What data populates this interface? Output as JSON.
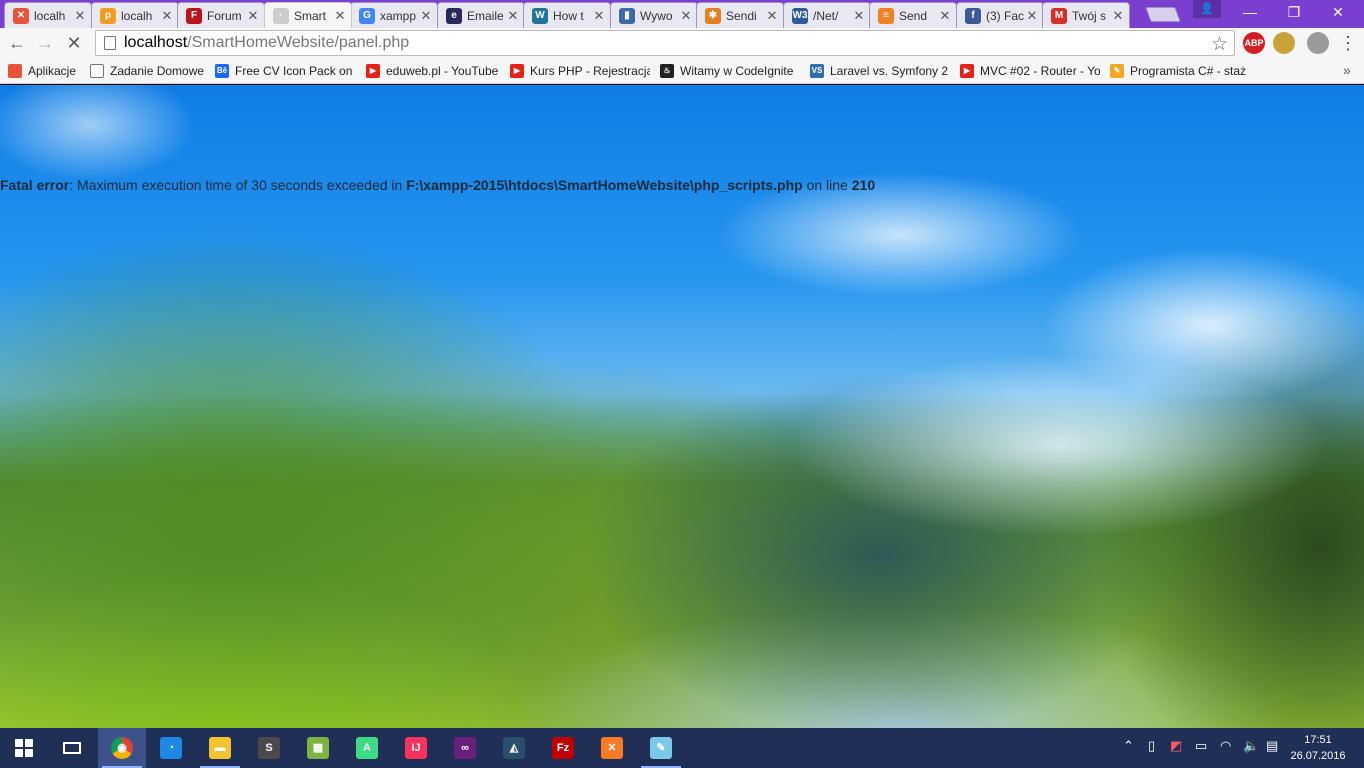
{
  "colors": {
    "titlebar": "#7a3fd1",
    "toolbar": "#f6f6f6",
    "taskbar": "#1f2f55"
  },
  "tabs": [
    {
      "label": "localh",
      "icon": "xampp-icon",
      "color": "#e8543a",
      "glyph": "✕"
    },
    {
      "label": "localh",
      "icon": "phpmyadmin-icon",
      "color": "#f39c1f",
      "glyph": "p"
    },
    {
      "label": "Forum",
      "icon": "forum-icon",
      "color": "#b8161b",
      "glyph": "F"
    },
    {
      "label": "Smart",
      "icon": "loading-icon",
      "color": "#cccccc",
      "glyph": "·",
      "active": true
    },
    {
      "label": "xampp",
      "icon": "google-icon",
      "color": "#4285f4",
      "glyph": "G"
    },
    {
      "label": "Emaile",
      "icon": "ie-icon",
      "color": "#2a2a5a",
      "glyph": "e"
    },
    {
      "label": "How t",
      "icon": "wordpress-icon",
      "color": "#21759b",
      "glyph": "W"
    },
    {
      "label": "Wywo",
      "icon": "bookmark-icon",
      "color": "#3a6aa8",
      "glyph": "▮"
    },
    {
      "label": "Sendi",
      "icon": "asterisk-icon",
      "color": "#e67e22",
      "glyph": "✱"
    },
    {
      "label": "/Net/",
      "icon": "w3schools-icon",
      "color": "#2e5c9a",
      "glyph": "W3"
    },
    {
      "label": "Send",
      "icon": "stackoverflow-icon",
      "color": "#f48024",
      "glyph": "≡"
    },
    {
      "label": "(3) Fac",
      "icon": "facebook-icon",
      "color": "#3b5998",
      "glyph": "f"
    },
    {
      "label": "Twój s",
      "icon": "gmail-icon",
      "color": "#d93025",
      "glyph": "M"
    }
  ],
  "toolbar": {
    "url_host": "localhost",
    "url_path": "/SmartHomeWebsite/panel.php",
    "extensions": [
      {
        "name": "adblock-plus-icon",
        "label": "ABP",
        "color": "#d21f26"
      },
      {
        "name": "extension-bread-icon",
        "label": "",
        "color": "#c9a23a"
      },
      {
        "name": "extension-globe-icon",
        "label": "",
        "color": "#9a9a9a"
      }
    ]
  },
  "bookmarks": [
    {
      "label": "Aplikacje",
      "icon": "apps-grid-icon",
      "color": "#e8543a"
    },
    {
      "label": "Zadanie Domowe",
      "icon": "page-icon",
      "color": "#ffffff"
    },
    {
      "label": "Free CV Icon Pack on",
      "icon": "behance-icon",
      "color": "#1769ff",
      "glyph": "Bē"
    },
    {
      "label": "eduweb.pl - YouTube",
      "icon": "youtube-icon",
      "color": "#e62117",
      "glyph": "▶"
    },
    {
      "label": "Kurs PHP - Rejestracja",
      "icon": "youtube-icon",
      "color": "#e62117",
      "glyph": "▶"
    },
    {
      "label": "Witamy w CodeIgnite",
      "icon": "codeigniter-icon",
      "color": "#222222",
      "glyph": "♨"
    },
    {
      "label": "Laravel vs. Symfony 2",
      "icon": "vs-icon",
      "color": "#2e6db5",
      "glyph": "VS"
    },
    {
      "label": "MVC #02 - Router - Yo",
      "icon": "youtube-icon",
      "color": "#e62117",
      "glyph": "▶"
    },
    {
      "label": "Programista C# - staż",
      "icon": "pencil-icon",
      "color": "#f5a623",
      "glyph": "✎"
    }
  ],
  "page": {
    "error_label": "Fatal error",
    "error_message": ": Maximum execution time of 30 seconds exceeded in ",
    "error_file": "F:\\xampp-2015\\htdocs\\SmartHomeWebsite\\php_scripts.php",
    "error_online": " on line ",
    "error_line": "210"
  },
  "taskbar": {
    "apps": [
      {
        "name": "chrome-icon",
        "color": "#db4437",
        "glyph": "◉",
        "active": true
      },
      {
        "name": "lightshot-icon",
        "color": "#1e88e5",
        "glyph": "◔"
      },
      {
        "name": "file-explorer-icon",
        "color": "#f2c230",
        "glyph": "▬"
      },
      {
        "name": "sublime-text-icon",
        "color": "#4a4a4a",
        "glyph": "S"
      },
      {
        "name": "colorful-app-icon",
        "color": "#7cb342",
        "glyph": "▦"
      },
      {
        "name": "android-studio-icon",
        "color": "#3ddc84",
        "glyph": "A"
      },
      {
        "name": "intellij-icon",
        "color": "#fe315d",
        "glyph": "IJ"
      },
      {
        "name": "visual-studio-icon",
        "color": "#68217a",
        "glyph": "∞"
      },
      {
        "name": "mysql-workbench-icon",
        "color": "#2a4e6c",
        "glyph": "◭"
      },
      {
        "name": "filezilla-icon",
        "color": "#bf0000",
        "glyph": "Fz"
      },
      {
        "name": "xampp-icon",
        "color": "#fb7a24",
        "glyph": "✕"
      },
      {
        "name": "notepad-icon",
        "color": "#7cc8e8",
        "glyph": "✎"
      }
    ],
    "clock_time": "17:51",
    "clock_date": "26.07.2016"
  }
}
